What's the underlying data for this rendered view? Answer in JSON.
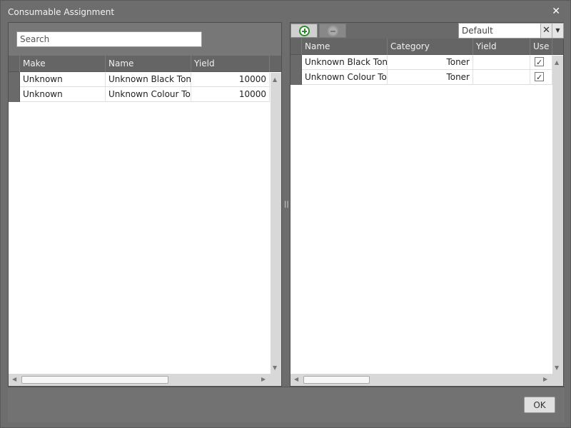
{
  "window": {
    "title": "Consumable Assignment",
    "close_glyph": "✕"
  },
  "left": {
    "search_placeholder": "Search",
    "columns": [
      "Make",
      "Name",
      "Yield"
    ],
    "rows": [
      {
        "make": "Unknown",
        "name": "Unknown Black Toner",
        "yield": "10000"
      },
      {
        "make": "Unknown",
        "name": "Unknown Colour Toner",
        "yield": "10000"
      }
    ]
  },
  "right": {
    "combo_value": "Default",
    "columns": [
      "Name",
      "Category",
      "Yield",
      "Use"
    ],
    "rows": [
      {
        "name": "Unknown Black Toner",
        "category": "Toner",
        "yield": "",
        "use": true
      },
      {
        "name": "Unknown Colour Toner",
        "category": "Toner",
        "yield": "",
        "use": true
      }
    ]
  },
  "footer": {
    "ok_label": "OK"
  },
  "icons": {
    "add": "plus-circle-icon",
    "remove": "minus-circle-icon",
    "close": "close-icon",
    "clear": "clear-icon",
    "dropdown": "chevron-down-icon"
  }
}
